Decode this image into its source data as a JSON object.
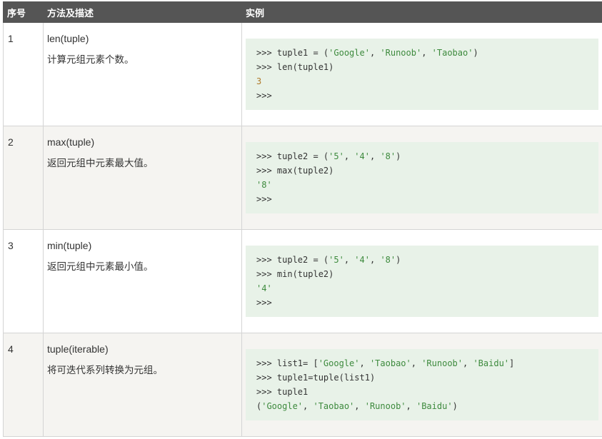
{
  "headers": [
    "序号",
    "方法及描述",
    "实例"
  ],
  "rows": [
    {
      "num": "1",
      "method": "len(tuple)",
      "desc": "计算元组元素个数。",
      "code": [
        [
          {
            "t": ">>> tuple1 = ("
          },
          {
            "t": "'Google'",
            "s": "str"
          },
          {
            "t": ", "
          },
          {
            "t": "'Runoob'",
            "s": "str"
          },
          {
            "t": ", "
          },
          {
            "t": "'Taobao'",
            "s": "str"
          },
          {
            "t": ")"
          }
        ],
        [
          {
            "t": ">>> len(tuple1)"
          }
        ],
        [
          {
            "t": "3",
            "s": "out-num"
          }
        ],
        [
          {
            "t": ">>>"
          }
        ]
      ]
    },
    {
      "num": "2",
      "method": "max(tuple)",
      "desc": "返回元组中元素最大值。",
      "code": [
        [
          {
            "t": ">>> tuple2 = ("
          },
          {
            "t": "'5'",
            "s": "str"
          },
          {
            "t": ", "
          },
          {
            "t": "'4'",
            "s": "str"
          },
          {
            "t": ", "
          },
          {
            "t": "'8'",
            "s": "str"
          },
          {
            "t": ")"
          }
        ],
        [
          {
            "t": ">>> max(tuple2)"
          }
        ],
        [
          {
            "t": "'8'",
            "s": "str"
          }
        ],
        [
          {
            "t": ">>>"
          }
        ]
      ]
    },
    {
      "num": "3",
      "method": "min(tuple)",
      "desc": "返回元组中元素最小值。",
      "code": [
        [
          {
            "t": ">>> tuple2 = ("
          },
          {
            "t": "'5'",
            "s": "str"
          },
          {
            "t": ", "
          },
          {
            "t": "'4'",
            "s": "str"
          },
          {
            "t": ", "
          },
          {
            "t": "'8'",
            "s": "str"
          },
          {
            "t": ")"
          }
        ],
        [
          {
            "t": ">>> min(tuple2)"
          }
        ],
        [
          {
            "t": "'4'",
            "s": "str"
          }
        ],
        [
          {
            "t": ">>>"
          }
        ]
      ]
    },
    {
      "num": "4",
      "method": "tuple(iterable)",
      "desc": "将可迭代系列转换为元组。",
      "code": [
        [
          {
            "t": ">>> list1= ["
          },
          {
            "t": "'Google'",
            "s": "str"
          },
          {
            "t": ", "
          },
          {
            "t": "'Taobao'",
            "s": "str"
          },
          {
            "t": ", "
          },
          {
            "t": "'Runoob'",
            "s": "str"
          },
          {
            "t": ", "
          },
          {
            "t": "'Baidu'",
            "s": "str"
          },
          {
            "t": "]"
          }
        ],
        [
          {
            "t": ">>> tuple1=tuple(list1)"
          }
        ],
        [
          {
            "t": ">>> tuple1"
          }
        ],
        [
          {
            "t": "("
          },
          {
            "t": "'Google'",
            "s": "str"
          },
          {
            "t": ", "
          },
          {
            "t": "'Taobao'",
            "s": "str"
          },
          {
            "t": ", "
          },
          {
            "t": "'Runoob'",
            "s": "str"
          },
          {
            "t": ", "
          },
          {
            "t": "'Baidu'",
            "s": "str"
          },
          {
            "t": ")"
          }
        ]
      ]
    }
  ]
}
